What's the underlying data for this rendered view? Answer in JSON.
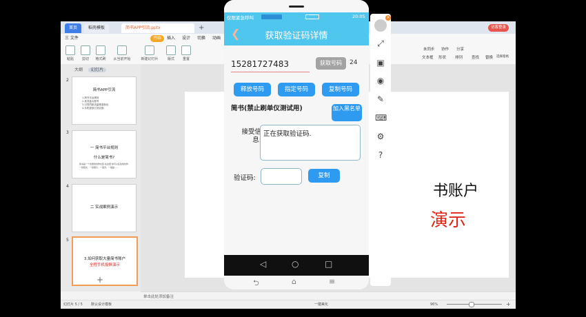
{
  "app": {
    "tabs": {
      "home": "首页",
      "store": "稻壳模板",
      "doc": "简书APP引流.pptx"
    },
    "login": "访客登录",
    "menu": [
      "三 文件",
      "开始",
      "插入",
      "设计",
      "切换",
      "动画"
    ],
    "tools": [
      "粘贴",
      "剪切",
      "格式刷",
      "从当前开始",
      "新建幻灯片",
      "版式",
      "重置"
    ],
    "right_tools": [
      "未同步",
      "协作",
      "分享",
      "文本框",
      "形状",
      "排列",
      "查找",
      "替换",
      "选择窗格"
    ],
    "panel_tabs": {
      "outline": "大纲",
      "slides": "幻灯片"
    },
    "slides": [
      {
        "num": "2",
        "title": "简书APP引流",
        "lines": [
          "1.简书平台规则",
          "2.找流量大账号",
          "3.引导同款流量精准粉丝",
          "4.手机投放引流实操"
        ]
      },
      {
        "num": "3",
        "title": "一 简书平台规则",
        "subtitle": "什么是简书?",
        "lines": [
          "简书是一个优质的创作社区,在这里,你可以任性地创作,一篇短文、一张照片、一首诗、一幅画……"
        ]
      },
      {
        "num": "4",
        "title": "二 实战案例演示"
      },
      {
        "num": "5",
        "title": "3.如何获取大量简书账户",
        "red": "全程手机投屏演示"
      }
    ],
    "slide_text": {
      "line1": "书账户",
      "line2": "演示"
    },
    "notes": "单击此处添加备注",
    "status": {
      "slide": "幻灯片 5 / 5",
      "theme": "默认设计模板",
      "beautify": "一键美化",
      "zoom": "96%"
    }
  },
  "phone": {
    "status_left": "仅限紧急呼叫",
    "status_right": "20:05",
    "title": "获取验证码详情",
    "number": "15281727483",
    "get_number": "获取号码",
    "count": "24",
    "release": "释放号码",
    "assign": "指定号码",
    "copy_number": "复制号码",
    "project": "简书(禁止刷单仪测试用)",
    "blacklist": "加入黑名单",
    "recv_label": "接受信息:",
    "recv_text": "正在获取验证码.",
    "code_label": "验证码:",
    "copy_code": "复制"
  }
}
